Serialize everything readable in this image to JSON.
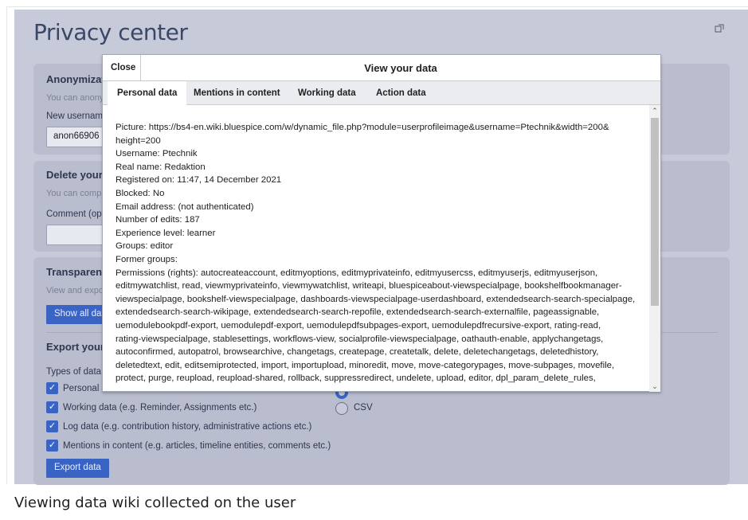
{
  "page": {
    "title": "Privacy center",
    "expand_icon": "external-popup-icon"
  },
  "sections": {
    "anonymization": {
      "heading": "Anonymizat",
      "description": "You can anony",
      "new_username_label": "New usernam",
      "new_username_value": "anon66906"
    },
    "delete": {
      "heading": "Delete your",
      "description": "You can comp",
      "comment_label": "Comment (opt"
    },
    "transparency": {
      "heading": "Transparenc",
      "description": "View and expo",
      "show_all_button": "Show all dat",
      "export_heading": "Export your",
      "types_label": "Types of data",
      "checkboxes": [
        "Personal d",
        "Working data (e.g. Reminder, Assignments etc.)",
        "Log data (e.g. contribution history, administrative actions etc.)",
        "Mentions in content (e.g. articles, timeline entities, comments etc.)"
      ],
      "format_options": [
        "CSV"
      ],
      "export_button": "Export data"
    }
  },
  "dialog": {
    "close_label": "Close",
    "title": "View your data",
    "tabs": [
      "Personal data",
      "Mentions in content",
      "Working data",
      "Action data"
    ],
    "active_tab": "Personal data",
    "lines": [
      "Picture: https://bs4-en.wiki.bluespice.com/w/dynamic_file.php?module=userprofileimage&username=Ptechnik&width=200&",
      "height=200",
      "Username: Ptechnik",
      "Real name: Redaktion",
      "Registered on: 11:47, 14 December 2021",
      "Blocked: No",
      "Email address: (not authenticated)",
      "Number of edits: 187",
      "Experience level: learner",
      "Groups: editor",
      "Former groups:",
      "Permissions (rights): autocreateaccount, editmyoptions, editmyprivateinfo, editmyusercss, editmyuserjs, editmyuserjson,",
      "editmywatchlist, read, viewmyprivateinfo, viewmywatchlist, writeapi, bluespiceabout-viewspecialpage, bookshelfbookmanager-",
      "viewspecialpage, bookshelf-viewspecialpage, dashboards-viewspecialpage-userdashboard, extendedsearch-search-specialpage,",
      "extendedsearch-search-wikipage, extendedsearch-search-repofile, extendedsearch-search-externalfile, pageassignable,",
      "uemodulebookpdf-export, uemodulepdf-export, uemodulepdfsubpages-export, uemodulepdfrecursive-export, rating-read,",
      "rating-viewspecialpage, stablesettings, workflows-view, socialprofile-viewspecialpage, oathauth-enable, applychangetags,",
      "autoconfirmed, autopatrol, browsearchive, changetags, createpage, createtalk, delete, deletechangetags, deletedhistory,",
      "deletedtext, edit, editsemiprotected, import, importupload, minoredit, move, move-categorypages, move-subpages, movefile,",
      "protect, purge, reupload, reupload-shared, rollback, suppressredirect, undelete, upload, editor, dpl_param_delete_rules,"
    ]
  },
  "caption": "Viewing data wiki collected on the user",
  "colors": {
    "overlay": "#c7cbd9",
    "panel": "#b9bdcd",
    "accent": "#3a64c4"
  }
}
